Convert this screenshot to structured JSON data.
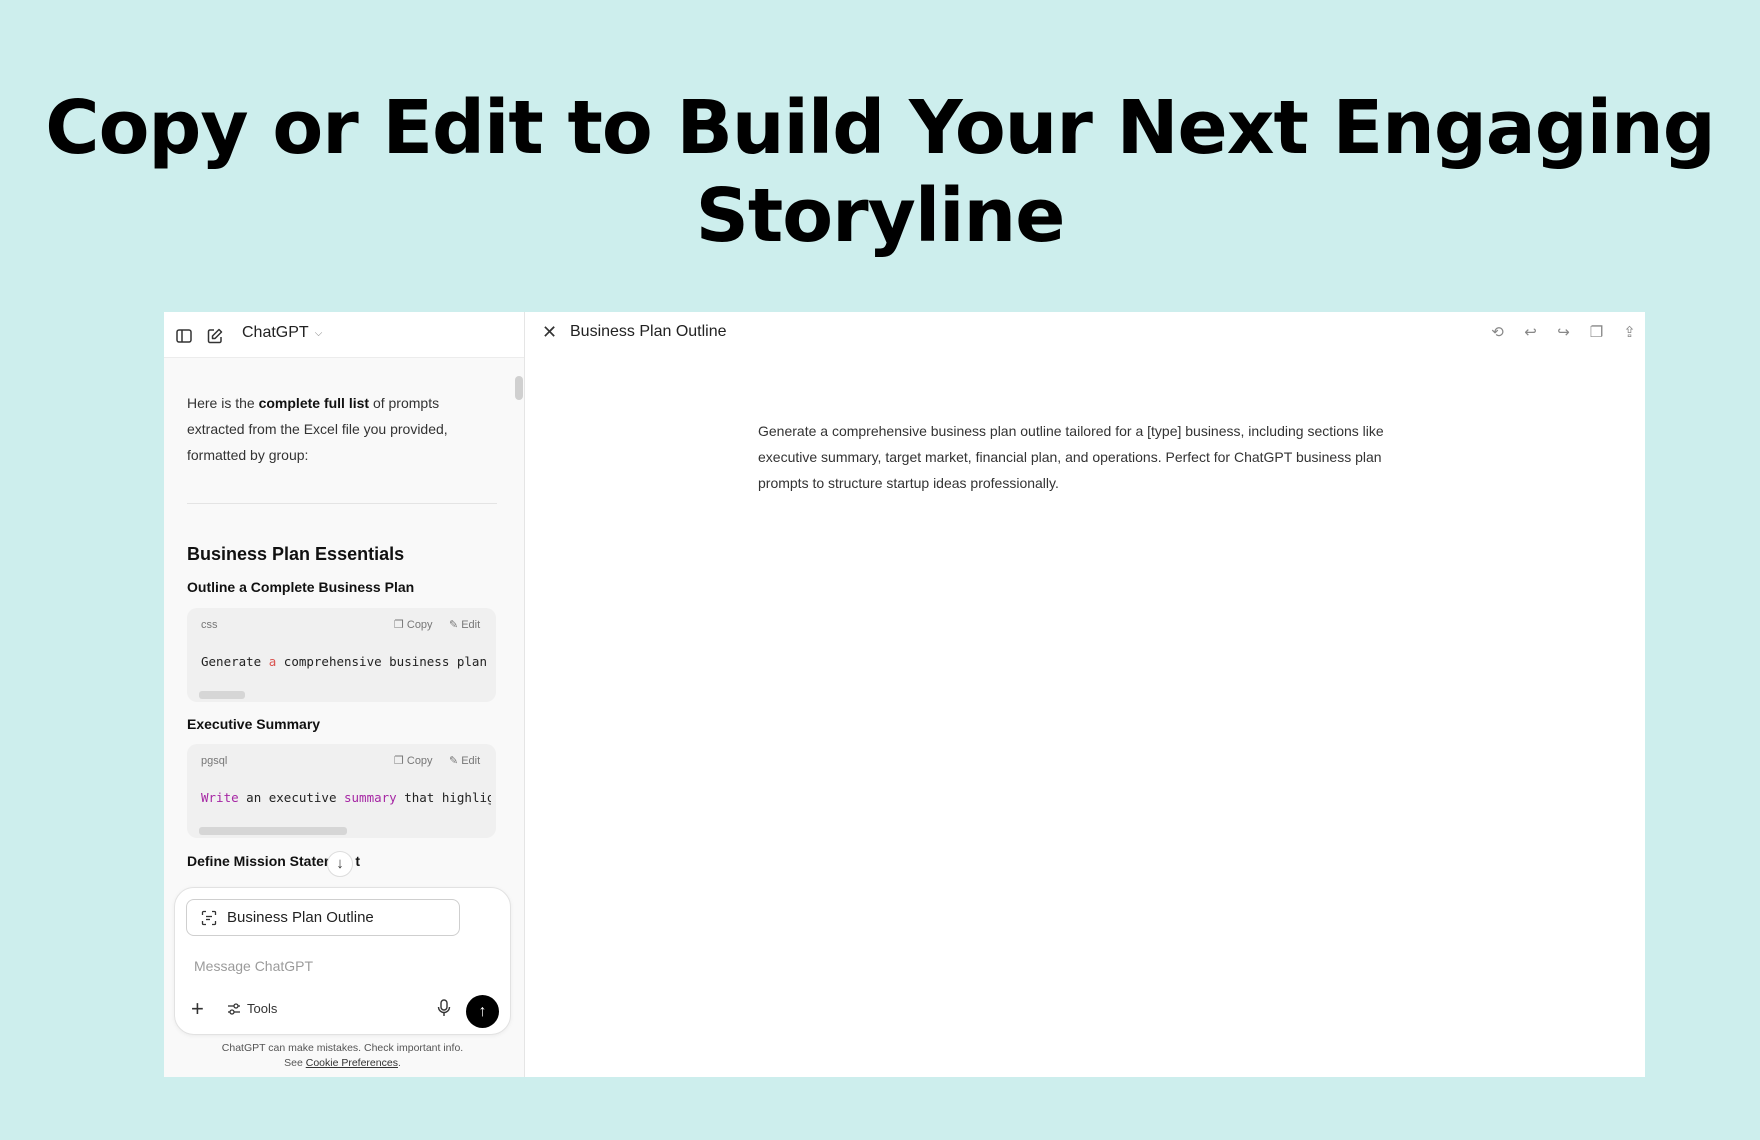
{
  "headline": "Copy or Edit to Build Your Next Engaging Storyline",
  "sidebar": {
    "app_name": "ChatGPT",
    "intro_pre": "Here is the ",
    "intro_bold": "complete full list",
    "intro_post": " of prompts extracted from the Excel file you provided, formatted by group:",
    "section_heading": "Business Plan Essentials",
    "items": [
      {
        "title": "Outline a Complete Business Plan",
        "lang": "css",
        "copy": "Copy",
        "edit": "Edit",
        "code_t1": "Generate ",
        "code_t2": "a",
        "code_t3": " comprehensive business plan"
      },
      {
        "title": "Executive Summary",
        "lang": "pgsql",
        "copy": "Copy",
        "edit": "Edit",
        "code_t1": "Write",
        "code_t2": " an executive ",
        "code_t3": "summary",
        "code_t4": " that highlig"
      }
    ],
    "truncated_heading": "Define Mission Stater",
    "truncated_tail": "t"
  },
  "composer": {
    "chip_label": "Business Plan Outline",
    "placeholder": "Message ChatGPT",
    "tools_label": "Tools"
  },
  "footer": {
    "line1": "ChatGPT can make mistakes. Check important info.",
    "see": "See ",
    "link": "Cookie Preferences",
    "end": "."
  },
  "canvas": {
    "title": "Business Plan Outline",
    "body": "Generate a comprehensive business plan outline tailored for a [type] business, including sections like executive summary, target market, financial plan, and operations. Perfect for ChatGPT business plan prompts to structure startup ideas professionally."
  }
}
